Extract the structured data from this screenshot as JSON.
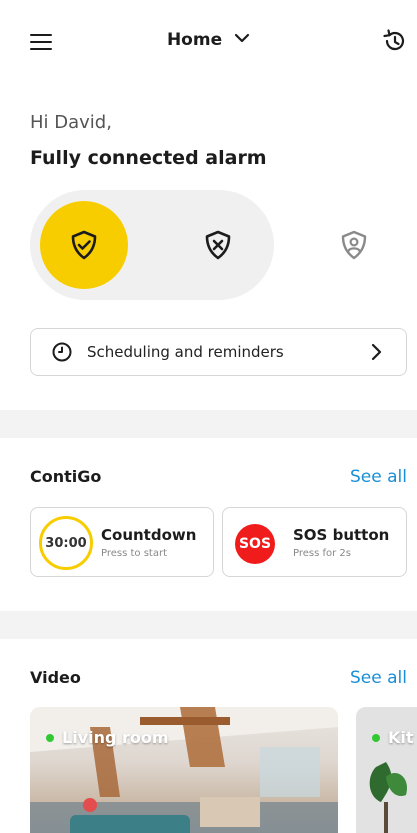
{
  "header": {
    "title": "Home",
    "menu_icon": "hamburger-menu-icon",
    "history_icon": "history-icon"
  },
  "greeting": "Hi David,",
  "status_title": "Fully connected alarm",
  "arm_modes": [
    {
      "icon": "shield-check-icon",
      "state": "active"
    },
    {
      "icon": "shield-x-icon",
      "state": "inactive"
    },
    {
      "icon": "shield-person-icon",
      "state": "inactive"
    }
  ],
  "scheduling": {
    "label": "Scheduling and reminders"
  },
  "contigo": {
    "title": "ContiGo",
    "see_all": "See all",
    "countdown": {
      "timer": "30:00",
      "title": "Countdown",
      "subtitle": "Press to start"
    },
    "sos": {
      "badge": "SOS",
      "title": "SOS button",
      "subtitle": "Press for 2s"
    }
  },
  "video": {
    "title": "Video",
    "see_all": "See all",
    "cameras": [
      {
        "name": "Living room",
        "status": "online"
      },
      {
        "name": "Kitchen",
        "visible_text": "Kit",
        "status": "online"
      }
    ]
  },
  "colors": {
    "accent": "#f7cd00",
    "link": "#1a8fd6",
    "sos": "#f01c1c",
    "online": "#32c832"
  }
}
